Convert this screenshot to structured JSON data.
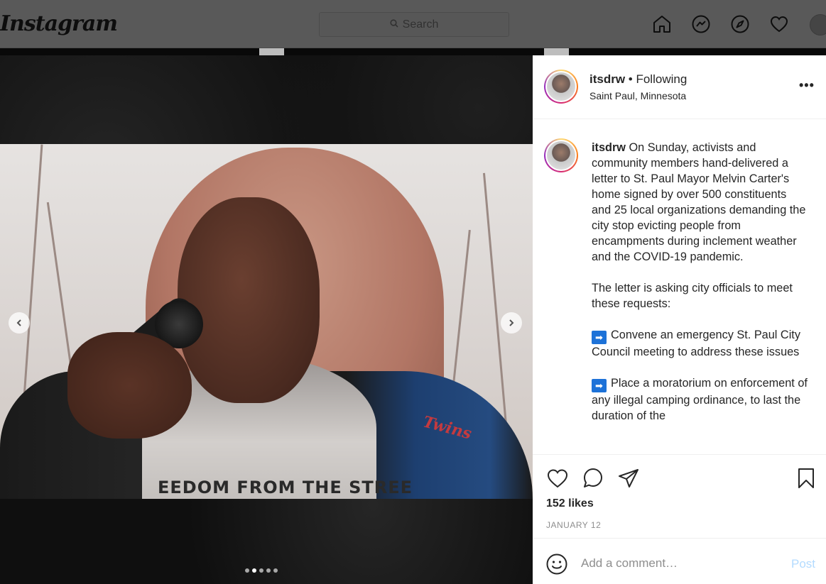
{
  "nav": {
    "logo": "Instagram",
    "search_placeholder": "Search",
    "icons": [
      "home-icon",
      "messenger-icon",
      "explore-icon",
      "activity-heart-icon",
      "profile-avatar"
    ]
  },
  "post": {
    "username": "itsdrw",
    "follow_status": "• Following",
    "location": "Saint Paul, Minnesota",
    "more_label": "•••",
    "caption": {
      "username": "itsdrw",
      "intro": "On Sunday, activists and community members hand-delivered a letter to St. Paul Mayor Melvin Carter's home signed by over 500 constituents and 25 local organizations demanding the city stop evicting people from encampments during inclement weather and the COVID-19 pandemic.",
      "para2": "The letter is asking city officials to meet these requests:",
      "item1": "Convene an emergency St. Paul City Council meeting to address these issues",
      "item2": "Place a moratorium on enforcement of any illegal camping ordinance, to last the duration of the"
    },
    "arrow_glyph": "➡",
    "likes": "152 likes",
    "date": "JANUARY 12",
    "comment_placeholder": "Add a comment…",
    "post_label": "Post",
    "photo_shirt_text": "EEDOM FROM THE STREE",
    "photo_patch_text": "Twins",
    "carousel": {
      "count": 5,
      "active": 1
    }
  },
  "colors": {
    "accent_disabled": "#b3dbff",
    "caption_arrow": "#1d72d8"
  }
}
